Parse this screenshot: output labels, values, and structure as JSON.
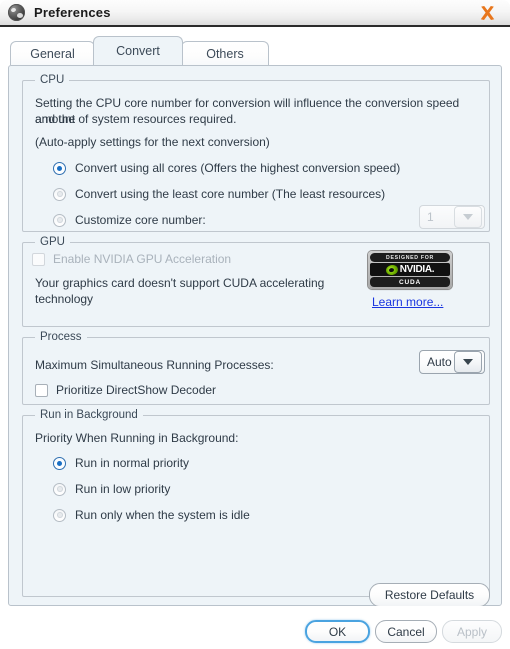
{
  "window": {
    "title": "Preferences",
    "app_icon": "globe-icon",
    "close_icon": "close-icon",
    "accent_color": "#e8761c",
    "content_bg": "#eef4f8"
  },
  "tabs": [
    {
      "label": "General",
      "selected": false
    },
    {
      "label": "Convert",
      "selected": true
    },
    {
      "label": "Others",
      "selected": false
    }
  ],
  "cpu": {
    "legend": "CPU",
    "description_line1": "Setting the CPU core number for conversion will influence the conversion speed and the",
    "description_line2": "amount of system resources required.",
    "auto_apply_note": "(Auto-apply settings for the next conversion)",
    "options": [
      {
        "label": "Convert using all cores (Offers the highest conversion speed)",
        "selected": true
      },
      {
        "label": "Convert using the least core number (The least resources)",
        "selected": false
      },
      {
        "label": "Customize core number:",
        "selected": false
      }
    ],
    "core_count_value": "1",
    "core_count_disabled": true
  },
  "gpu": {
    "legend": "GPU",
    "checkbox_label": "Enable NVIDIA GPU Acceleration",
    "checkbox_checked": false,
    "checkbox_disabled": true,
    "message_line1": "Your graphics card doesn't support CUDA accelerating",
    "message_line2": "technology",
    "learn_more_label": "Learn more...",
    "badge": {
      "top_text": "DESIGNED FOR",
      "brand_text": "NVIDIA.",
      "bottom_text": "CUDA",
      "logo_icon": "nvidia-eye-icon",
      "brand_color": "#76b900"
    }
  },
  "process": {
    "legend": "Process",
    "max_processes_label": "Maximum Simultaneous Running Processes:",
    "max_processes_value": "Auto",
    "directshow_label": "Prioritize DirectShow Decoder",
    "directshow_checked": false
  },
  "background": {
    "legend": "Run in Background",
    "priority_label": "Priority When Running in Background:",
    "options": [
      {
        "label": "Run in normal priority",
        "selected": true
      },
      {
        "label": "Run in low priority",
        "selected": false
      },
      {
        "label": "Run only when the system is idle",
        "selected": false
      }
    ]
  },
  "footer": {
    "restore_defaults_label": "Restore Defaults",
    "ok_label": "OK",
    "cancel_label": "Cancel",
    "apply_label": "Apply",
    "apply_disabled": true
  }
}
